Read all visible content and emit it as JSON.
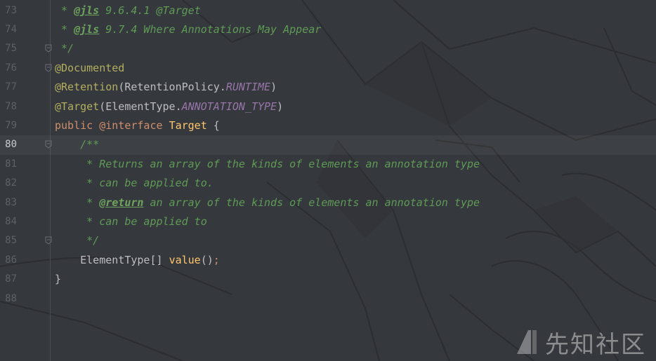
{
  "colors": {
    "background": "#35383c",
    "comment": "#5f9b56",
    "annotation": "#b3ae60",
    "keyword": "#cf8e6d",
    "constant": "#9876aa",
    "method": "#ffc66d",
    "text": "#bcbec4",
    "line_number": "#5d6168"
  },
  "current_line": "80",
  "lines": [
    {
      "num": "73",
      "fold": false,
      "parts": [
        {
          "t": " * ",
          "c": "c-doc"
        },
        {
          "t": "@jls",
          "c": "c-tag"
        },
        {
          "t": " 9.6.4.1 @Target",
          "c": "c-doc"
        }
      ]
    },
    {
      "num": "74",
      "fold": false,
      "parts": [
        {
          "t": " * ",
          "c": "c-doc"
        },
        {
          "t": "@jls",
          "c": "c-tag"
        },
        {
          "t": " 9.7.4 Where Annotations May Appear",
          "c": "c-doc"
        }
      ]
    },
    {
      "num": "75",
      "fold": true,
      "parts": [
        {
          "t": " */",
          "c": "c-doc"
        }
      ]
    },
    {
      "num": "76",
      "fold": true,
      "parts": [
        {
          "t": "@Documented",
          "c": "ann"
        }
      ]
    },
    {
      "num": "77",
      "fold": false,
      "parts": [
        {
          "t": "@Retention",
          "c": "ann"
        },
        {
          "t": "(RetentionPolicy.",
          "c": "txt"
        },
        {
          "t": "RUNTIME",
          "c": "const"
        },
        {
          "t": ")",
          "c": "txt"
        }
      ]
    },
    {
      "num": "78",
      "fold": false,
      "parts": [
        {
          "t": "@Target",
          "c": "ann"
        },
        {
          "t": "(ElementType.",
          "c": "txt"
        },
        {
          "t": "ANNOTATION_TYPE",
          "c": "const"
        },
        {
          "t": ")",
          "c": "txt"
        }
      ]
    },
    {
      "num": "79",
      "fold": false,
      "parts": [
        {
          "t": "public ",
          "c": "kw"
        },
        {
          "t": "@interface ",
          "c": "kw"
        },
        {
          "t": "Target ",
          "c": "fn"
        },
        {
          "t": "{",
          "c": "txt"
        }
      ]
    },
    {
      "num": "80",
      "fold": true,
      "parts": [
        {
          "t": "    /**",
          "c": "c-doc"
        }
      ]
    },
    {
      "num": "81",
      "fold": false,
      "parts": [
        {
          "t": "     * Returns an array of the kinds of elements an annotation type",
          "c": "c-doc"
        }
      ]
    },
    {
      "num": "82",
      "fold": false,
      "parts": [
        {
          "t": "     * can be applied to.",
          "c": "c-doc"
        }
      ]
    },
    {
      "num": "83",
      "fold": false,
      "parts": [
        {
          "t": "     * ",
          "c": "c-doc"
        },
        {
          "t": "@return",
          "c": "c-tag"
        },
        {
          "t": " an array of the kinds of elements an annotation type",
          "c": "c-doc"
        }
      ]
    },
    {
      "num": "84",
      "fold": false,
      "parts": [
        {
          "t": "     * can be applied to",
          "c": "c-doc"
        }
      ]
    },
    {
      "num": "85",
      "fold": true,
      "parts": [
        {
          "t": "     */",
          "c": "c-doc"
        }
      ]
    },
    {
      "num": "86",
      "fold": false,
      "parts": [
        {
          "t": "    ElementType[] ",
          "c": "txt"
        },
        {
          "t": "value",
          "c": "fn"
        },
        {
          "t": "()",
          "c": "txt"
        },
        {
          "t": ";",
          "c": "kw"
        }
      ]
    },
    {
      "num": "87",
      "fold": false,
      "parts": [
        {
          "t": "}",
          "c": "txt"
        }
      ]
    },
    {
      "num": "88",
      "fold": false,
      "parts": []
    }
  ],
  "watermark": {
    "text": "先知社区",
    "icon": "xianzhi-logo-icon"
  }
}
